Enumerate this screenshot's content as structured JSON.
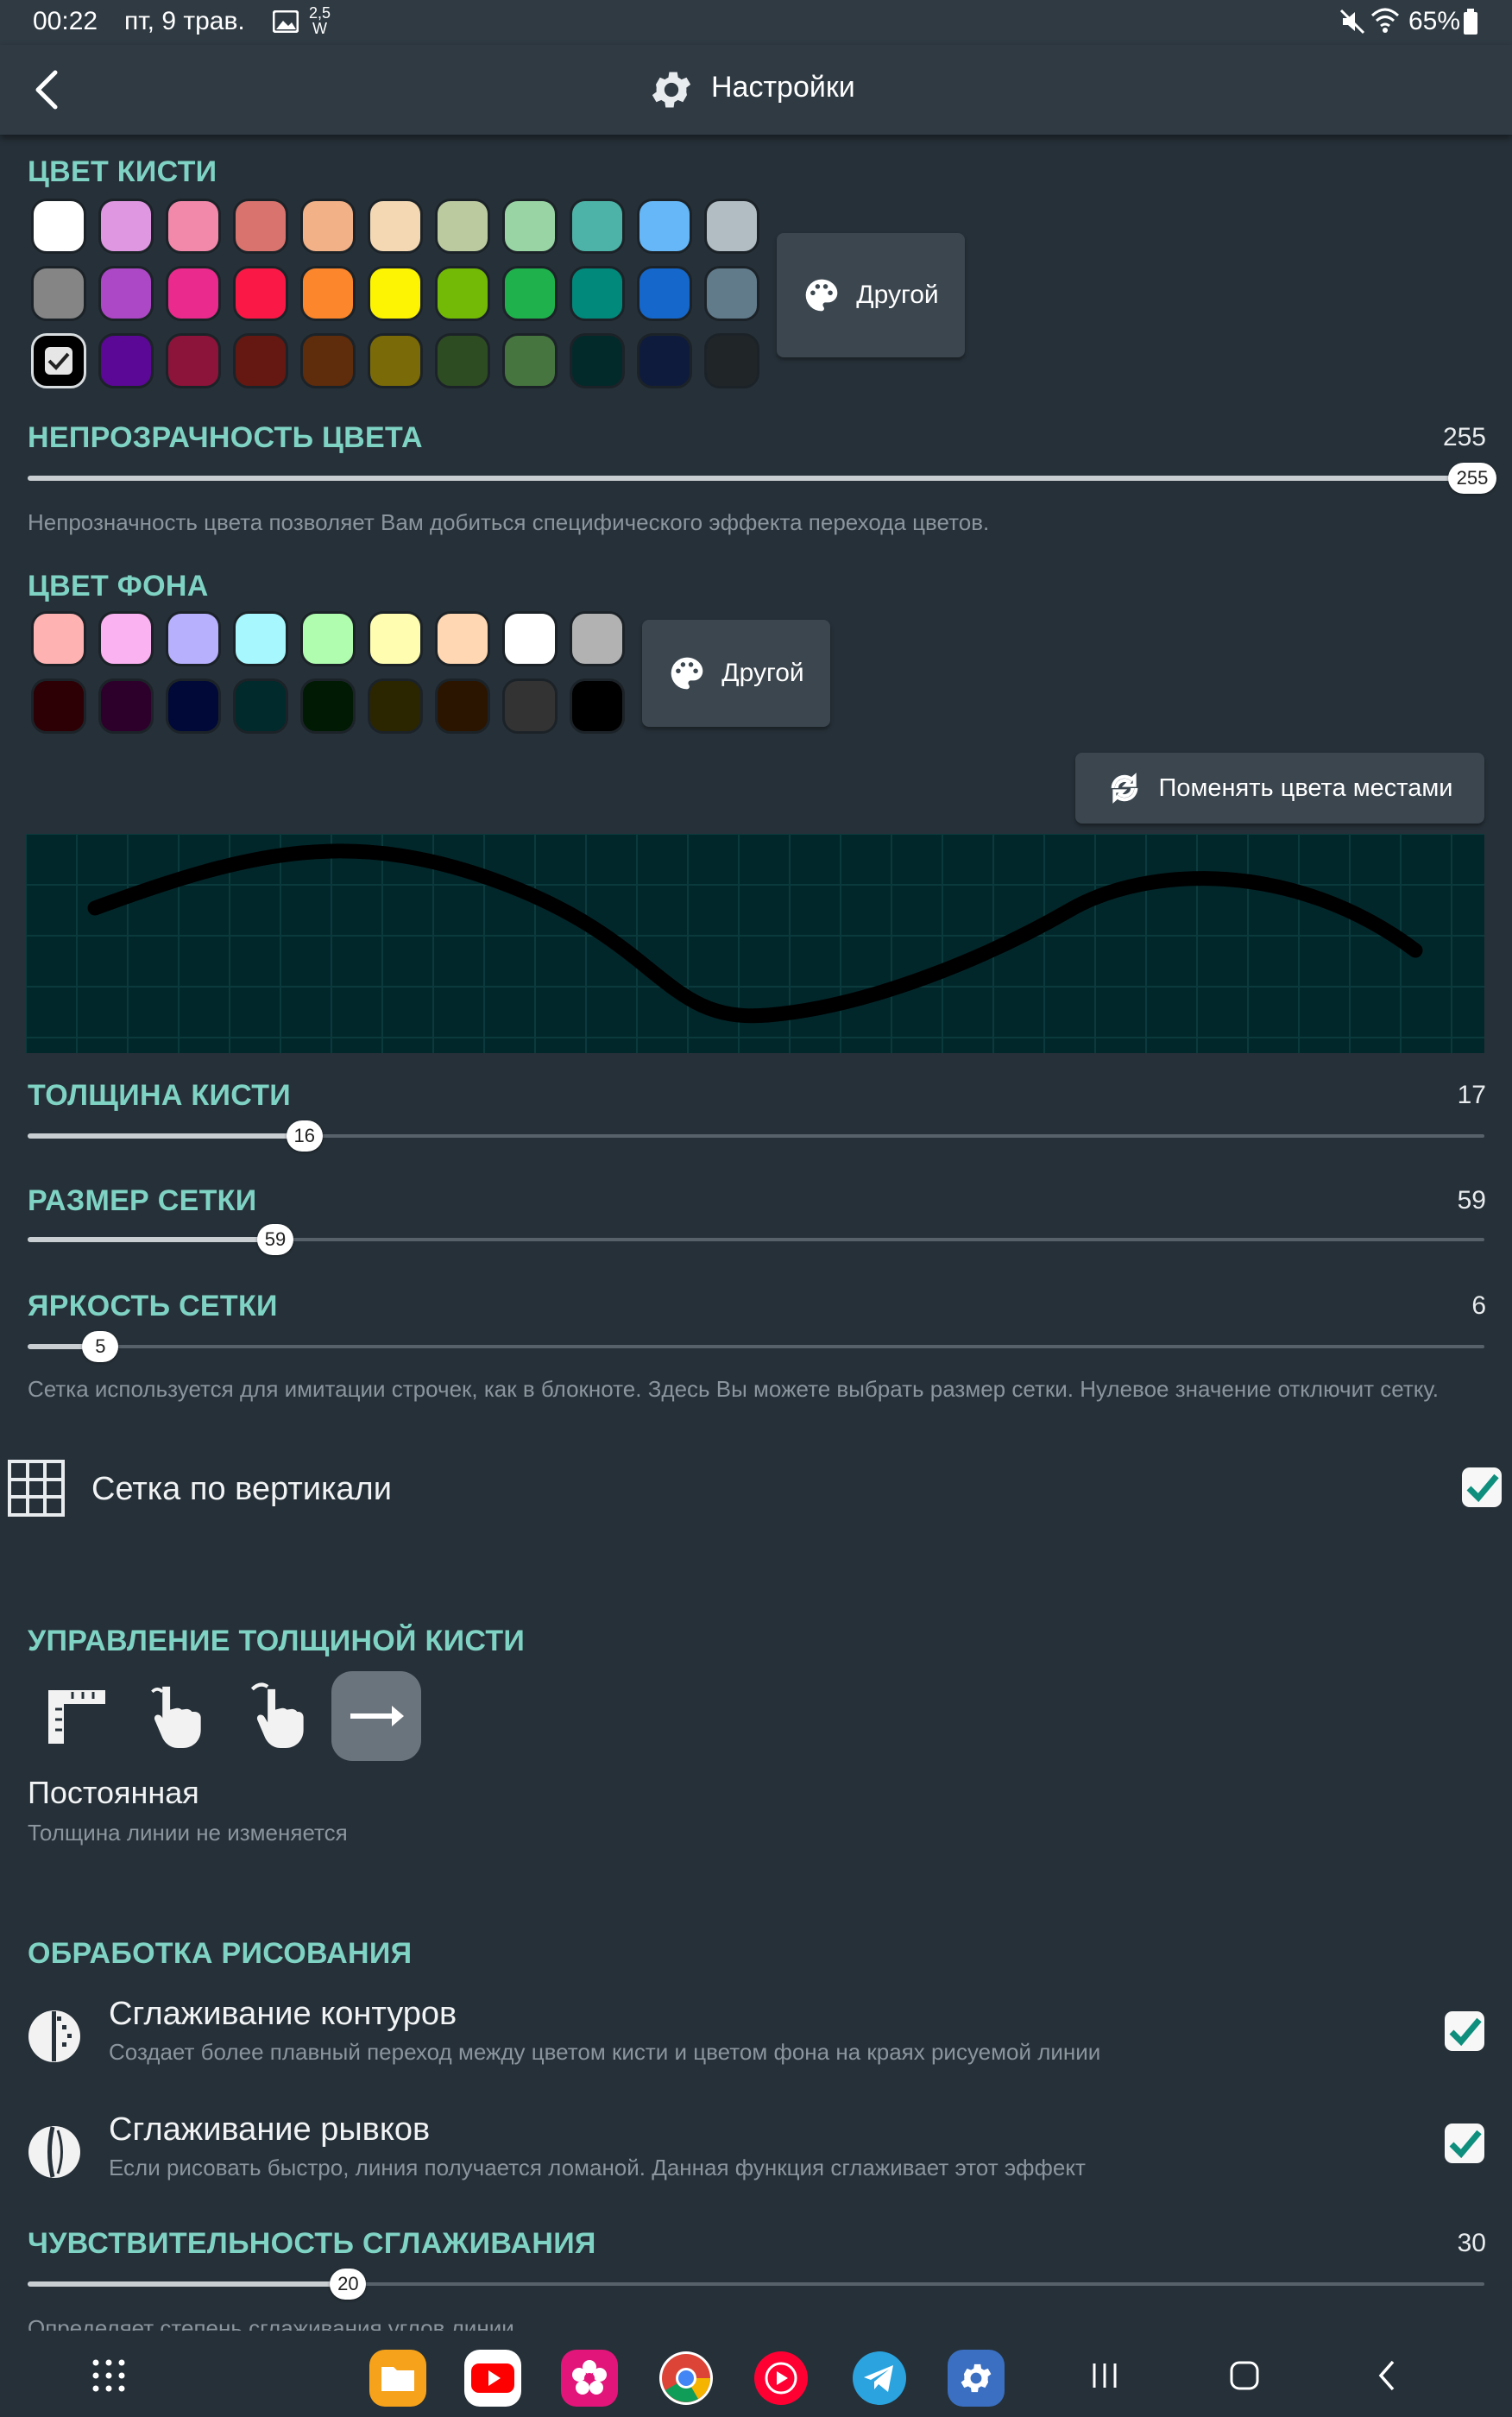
{
  "status_bar": {
    "time": "00:22",
    "date": "пт, 9 трав.",
    "speed_top": "2,5",
    "speed_bottom": "W",
    "battery": "65%"
  },
  "app_bar": {
    "title": "Настройки",
    "back_icon": "chevron-left-icon",
    "title_icon": "gear-icon"
  },
  "brush_color": {
    "title": "ЦВЕТ КИСТИ",
    "other_label": "Другой",
    "rows": [
      [
        "#ffffff",
        "#df97e1",
        "#f288aa",
        "#d8736e",
        "#f2b187",
        "#f3d8b3",
        "#bccaa0",
        "#99d4a4",
        "#4db3a8",
        "#66b7f7",
        "#b1bcc3"
      ],
      [
        "#858585",
        "#ac47c6",
        "#ea2a8c",
        "#fa1946",
        "#fb862b",
        "#fcf403",
        "#73ba06",
        "#1fb24c",
        "#01897b",
        "#1567cb",
        "#627b8b"
      ],
      [
        "#000000",
        "#5a0895",
        "#8c1339",
        "#641811",
        "#5f2c0c",
        "#7a6a08",
        "#2e4c22",
        "#467540",
        "#032a2b",
        "#0f1b3c",
        "#202528"
      ]
    ],
    "selected": "#000000"
  },
  "opacity": {
    "title": "НЕПРОЗРАЧНОСТЬ ЦВЕТА",
    "value": "255",
    "thumb": "255",
    "fraction": 1.0,
    "description": "Непрозначность цвета позволяет Вам добиться специфического эффекта перехода цветов."
  },
  "background_color": {
    "title": "ЦВЕТ ФОНА",
    "other_label": "Другой",
    "rows": [
      [
        "#feb2b2",
        "#fbb2f0",
        "#b6b0fd",
        "#a7f7ff",
        "#b0fdaf",
        "#fffdb0",
        "#ffd7b2",
        "#ffffff",
        "#b2b2b2"
      ],
      [
        "#2c0004",
        "#2d002c",
        "#000937",
        "#002a2b",
        "#001a04",
        "#2b2600",
        "#2b1500",
        "#333333",
        "#000000"
      ]
    ],
    "selected": "#002a2b"
  },
  "swap_button": {
    "label": "Поменять цвета местами",
    "icon": "swap-icon"
  },
  "preview": {
    "background": "#02272a",
    "stroke_color": "#000000"
  },
  "brush_width": {
    "title": "ТОЛЩИНА КИСТИ",
    "value": "17",
    "thumb": "16",
    "fraction": 0.19
  },
  "grid_size": {
    "title": "РАЗМЕР СЕТКИ",
    "value": "59",
    "thumb": "59",
    "fraction": 0.17
  },
  "grid_brightness": {
    "title": "ЯРКОСТЬ СЕТКИ",
    "value": "6",
    "thumb": "5",
    "fraction": 0.05,
    "description": "Сетка используется для имитации строчек, как в блокноте. Здесь Вы можете выбрать размер сетки. Нулевое значение отключит сетку."
  },
  "vertical_grid": {
    "label": "Сетка по вертикали",
    "checked": true,
    "icon": "grid-icon"
  },
  "width_control": {
    "title": "УПРАВЛЕНИЕ ТОЛЩИНОЙ КИСТИ",
    "modes": [
      "ruler-icon",
      "hand-pressure-icon",
      "hand-speed-icon",
      "arrow-right-icon"
    ],
    "selected_index": 3,
    "mode_name": "Постоянная",
    "mode_desc": "Толщина линии не изменяется"
  },
  "processing": {
    "title": "ОБРАБОТКА РИСОВАНИЯ",
    "items": [
      {
        "title": "Сглаживание контуров",
        "desc": "Создает более плавный переход между цветом кисти и цветом фона на краях рисуемой линии",
        "checked": true,
        "icon": "antialias-icon"
      },
      {
        "title": "Сглаживание рывков",
        "desc": "Если рисовать быстро, линия получается ломаной. Данная функция сглаживает этот эффект",
        "checked": true,
        "icon": "smoothing-icon"
      }
    ]
  },
  "smoothing_sensitivity": {
    "title": "ЧУВСТВИТЕЛЬНОСТЬ СГЛАЖИВАНИЯ",
    "value": "30",
    "thumb": "20",
    "fraction": 0.22,
    "description": "Определяет степень сглаживания углов линии"
  },
  "nav_bar": {
    "apps": [
      {
        "name": "files-app",
        "color": "#f6a31b"
      },
      {
        "name": "youtube-app",
        "color": "#ff0000"
      },
      {
        "name": "flower-app",
        "color": "#e2157a"
      },
      {
        "name": "chrome-app",
        "color": "#ffffff"
      },
      {
        "name": "youtube-music-app",
        "color": "#ff0033"
      },
      {
        "name": "telegram-app",
        "color": "#2aa3df"
      },
      {
        "name": "settings-app",
        "color": "#3a6fc1"
      }
    ]
  }
}
